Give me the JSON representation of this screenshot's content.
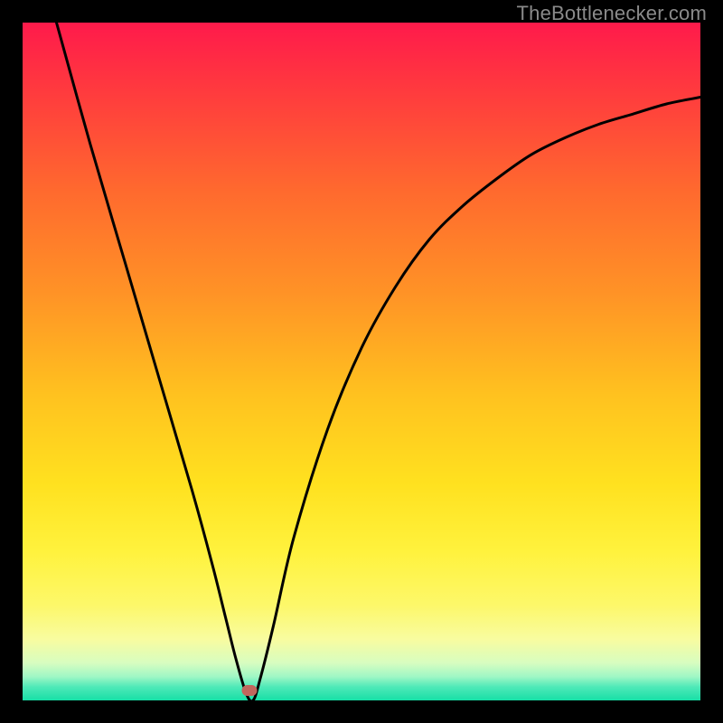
{
  "watermark": "TheBottlenecker.com",
  "marker": {
    "x_pct": 33.5,
    "y_pct": 98.5
  },
  "chart_data": {
    "type": "line",
    "title": "",
    "xlabel": "",
    "ylabel": "",
    "xlim": [
      0,
      100
    ],
    "ylim": [
      0,
      100
    ],
    "series": [
      {
        "name": "bottleneck-curve",
        "x": [
          5,
          10,
          15,
          20,
          25,
          28,
          30,
          31.5,
          33,
          34,
          35,
          37,
          40,
          45,
          50,
          55,
          60,
          65,
          70,
          75,
          80,
          85,
          90,
          95,
          100
        ],
        "values": [
          100,
          82,
          65,
          48,
          31,
          20,
          12,
          6,
          1,
          0,
          3,
          11,
          24,
          40,
          52,
          61,
          68,
          73,
          77,
          80.5,
          83,
          85,
          86.5,
          88,
          89
        ]
      }
    ],
    "annotations": [
      {
        "type": "marker",
        "x": 33.5,
        "y": 1.5
      }
    ],
    "background_gradient_stops": [
      {
        "pos": 0.0,
        "color": "#ff1a4b"
      },
      {
        "pos": 0.78,
        "color": "#fff23d"
      },
      {
        "pos": 1.0,
        "color": "#17dfa6"
      }
    ]
  }
}
